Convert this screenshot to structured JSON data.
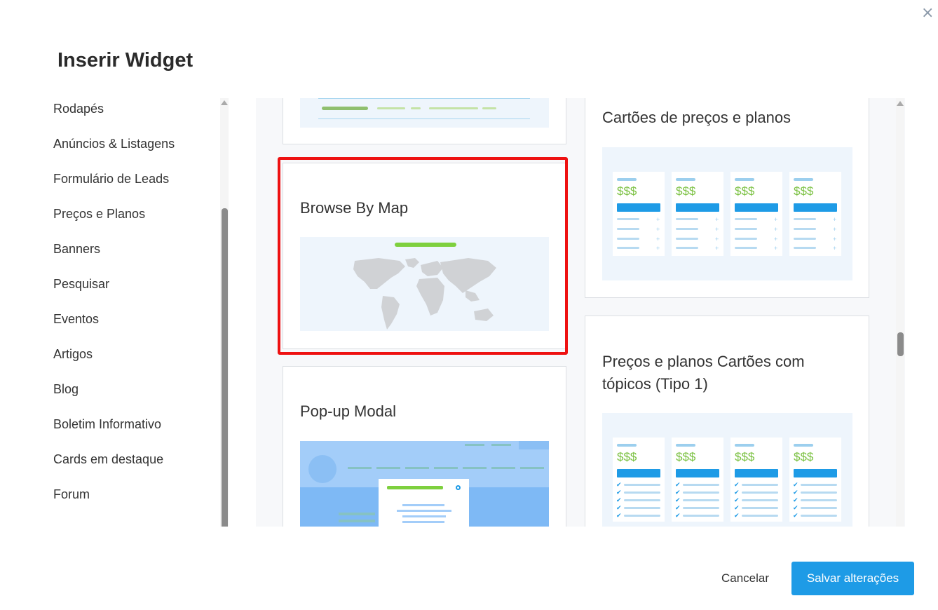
{
  "modal": {
    "title": "Inserir Widget",
    "close_glyph": "×"
  },
  "sidebar": {
    "items": [
      "Rodapés",
      "Anúncios & Listagens",
      "Formulário de Leads",
      "Preços e Planos",
      "Banners",
      "Pesquisar",
      "Eventos",
      "Artigos",
      "Blog",
      "Boletim Informativo",
      "Cards em destaque",
      "Forum"
    ]
  },
  "widgets": {
    "browse_by_map": {
      "title": "Browse By Map",
      "selected": true
    },
    "popup_modal": {
      "title": "Pop-up Modal"
    },
    "pricing_cards": {
      "title": "Cartões de preços e planos",
      "price_label": "$$$"
    },
    "pricing_topics": {
      "title": "Preços e planos Cartões com tópicos (Tipo 1)",
      "price_label": "$$$"
    }
  },
  "colors": {
    "accent": "#1e9be6",
    "selection": "#ee1111",
    "green": "#7bc142"
  },
  "footer": {
    "cancel_label": "Cancelar",
    "save_label": "Salvar alterações"
  }
}
